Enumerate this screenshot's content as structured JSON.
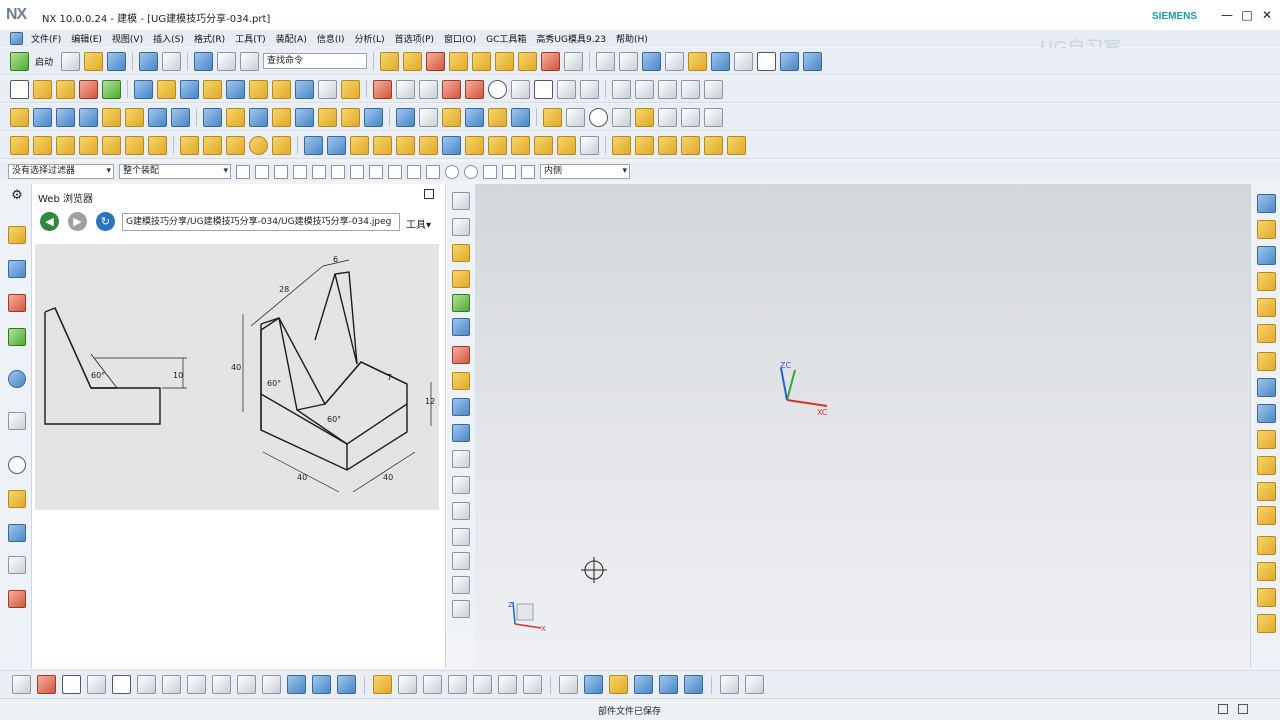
{
  "window": {
    "logo": "NX",
    "title": "NX 10.0.0.24 - 建模 - [UG建模技巧分享-034.prt]",
    "brand": "SIEMENS",
    "controls": [
      "—",
      "□",
      "✕"
    ]
  },
  "menubar": {
    "items": [
      "文件(F)",
      "编辑(E)",
      "视图(V)",
      "插入(S)",
      "格式(R)",
      "工具(T)",
      "装配(A)",
      "信息(I)",
      "分析(L)",
      "首选项(P)",
      "窗口(O)",
      "GC工具箱",
      "高秀UG模具9.23",
      "帮助(H)"
    ],
    "watermark": "UG自习室"
  },
  "toolbar": {
    "start_label": "启动",
    "command_search_placeholder": "查找命令"
  },
  "selection_bar": {
    "filter": "没有选择过滤器",
    "scope": "整个装配",
    "snap": "内侧"
  },
  "web_browser": {
    "title": "Web 浏览器",
    "url": "G建模技巧分享/UG建模技巧分享-034/UG建模技巧分享-034.jpeg",
    "tools_label": "工具"
  },
  "drawing_dims": {
    "d28": "28",
    "d6": "6",
    "d40_left": "40",
    "d10": "10",
    "d60a": "60°",
    "d60b": "60°",
    "d60c": "60°",
    "d7": "7",
    "d12": "12",
    "d40_a": "40",
    "d40_b": "40"
  },
  "triad": {
    "x": "XC",
    "z": "ZC",
    "small_x": "X",
    "small_z": "Z"
  },
  "status": {
    "message": "部件文件已保存"
  },
  "colors": {
    "accent_blue": "#1a9ba5",
    "axis_x": "#d0352b",
    "axis_y": "#2eaa2e",
    "axis_z": "#2760c8"
  }
}
